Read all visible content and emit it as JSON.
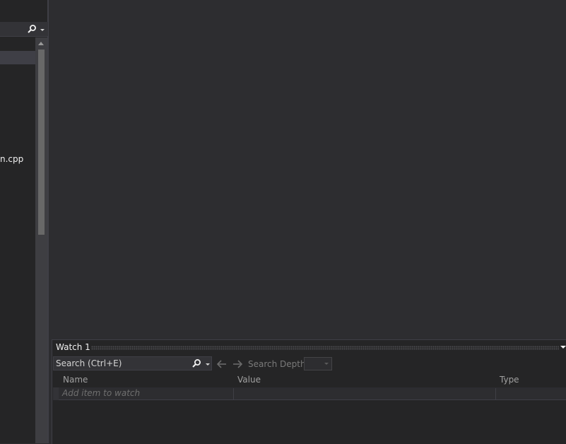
{
  "left_panel": {
    "file_item": "n.cpp"
  },
  "watch": {
    "title": "Watch 1",
    "search_placeholder": "Search (Ctrl+E)",
    "depth_label": "Search Depth:",
    "columns": {
      "name": "Name",
      "value": "Value",
      "type": "Type"
    },
    "add_item": "Add item to watch"
  },
  "icons": {
    "search": "search-icon",
    "dropdown": "chevron-down-icon",
    "back": "arrow-left-icon",
    "forward": "arrow-right-icon",
    "scroll_up": "scroll-up-icon",
    "menu": "window-menu-icon"
  },
  "colors": {
    "background": "#2d2d30",
    "panel": "#252526",
    "text": "#d4d4d4"
  }
}
